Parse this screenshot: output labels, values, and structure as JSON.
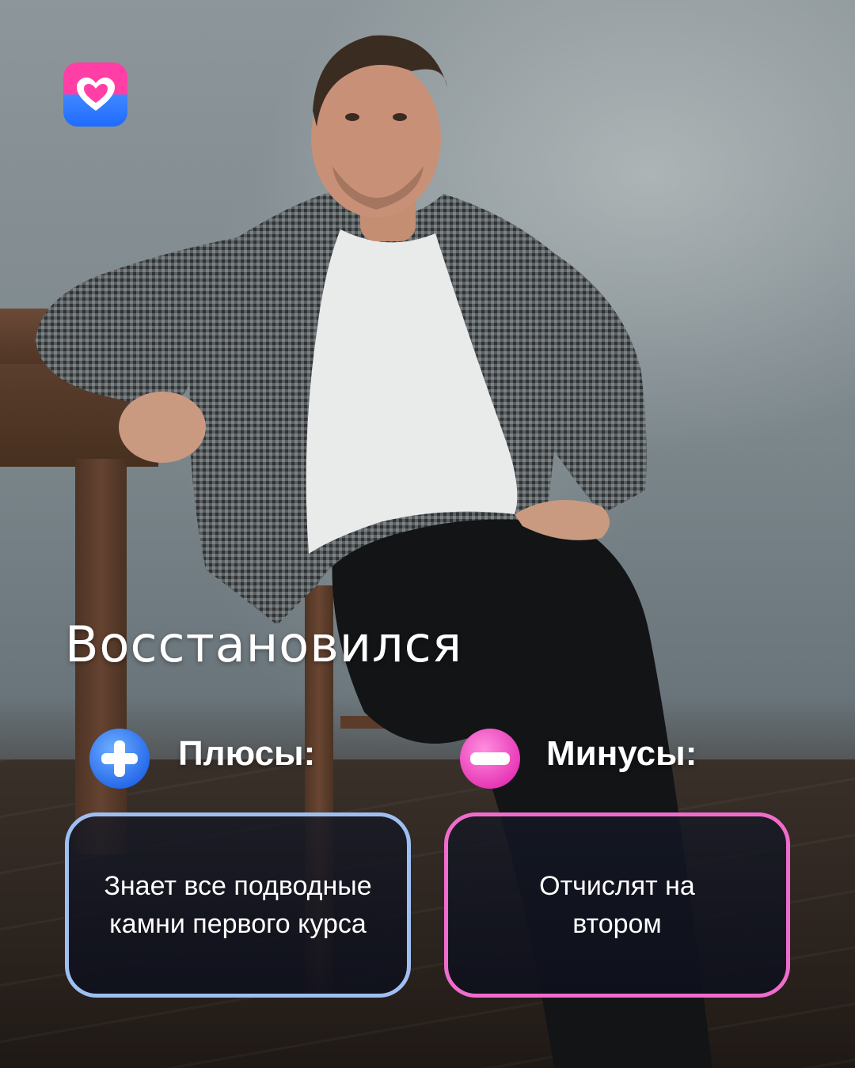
{
  "app": {
    "logo": "heart-logo"
  },
  "title": "Восстановился",
  "pros": {
    "icon": "plus-icon",
    "heading": "Плюсы:",
    "text": "Знает все подводные камни первого курса",
    "border_color": "#9fbff2"
  },
  "cons": {
    "icon": "minus-icon",
    "heading": "Минусы:",
    "text": "Отчислят на втором",
    "border_color": "#f06ccc"
  },
  "colors": {
    "logo_top": "#ff3fa5",
    "logo_bottom": "#1f6bff",
    "plus_icon": "#2f7dff",
    "minus_icon": "#ff4fc0"
  }
}
